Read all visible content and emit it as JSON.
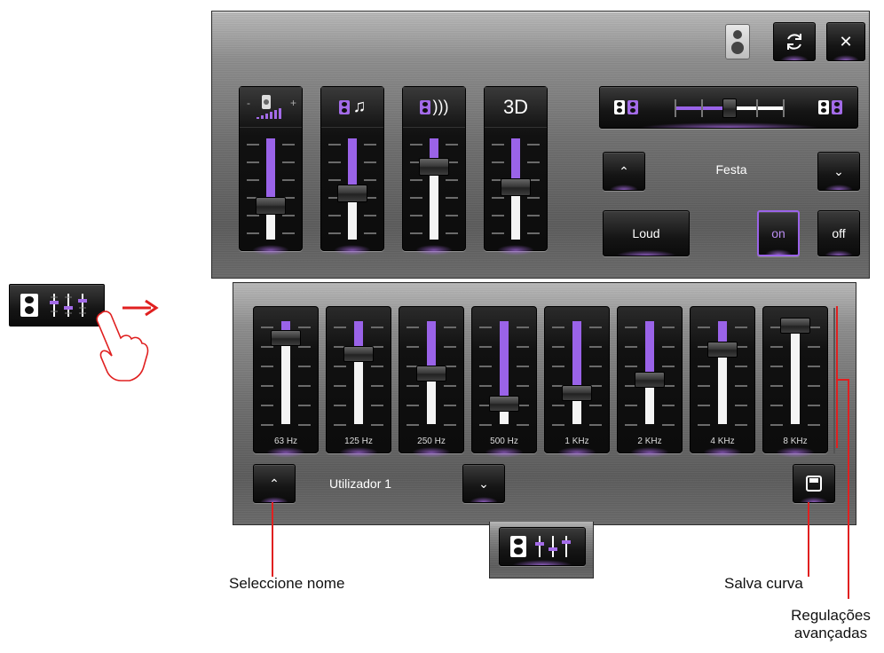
{
  "top_panel": {
    "mode_icons": [
      {
        "name": "volume-ramp-icon"
      },
      {
        "name": "speaker-music-icon"
      },
      {
        "name": "speaker-sound-icon"
      },
      {
        "label": "3D"
      }
    ],
    "mode_levels": [
      0.33,
      0.46,
      0.72,
      0.52
    ],
    "balance_level": 0.5,
    "preset_name": "Festa",
    "loud_label": "Loud",
    "on_label": "on",
    "off_label": "off"
  },
  "eq": {
    "bands": [
      {
        "label": "63 Hz",
        "level": 0.84
      },
      {
        "label": "125 Hz",
        "level": 0.68
      },
      {
        "label": "250 Hz",
        "level": 0.49
      },
      {
        "label": "500 Hz",
        "level": 0.2
      },
      {
        "label": "1 KHz",
        "level": 0.3
      },
      {
        "label": "2 KHz",
        "level": 0.43
      },
      {
        "label": "4 KHz",
        "level": 0.72
      },
      {
        "label": "8 KHz",
        "level": 0.96
      }
    ],
    "preset_name": "Utilizador 1"
  },
  "annotations": {
    "select_name": "Seleccione nome",
    "save_curve": "Salva curva",
    "advanced_line1": "Regulações",
    "advanced_line2": "avançadas"
  },
  "colors": {
    "accent": "#9a63e8",
    "arrow": "#e02020"
  }
}
